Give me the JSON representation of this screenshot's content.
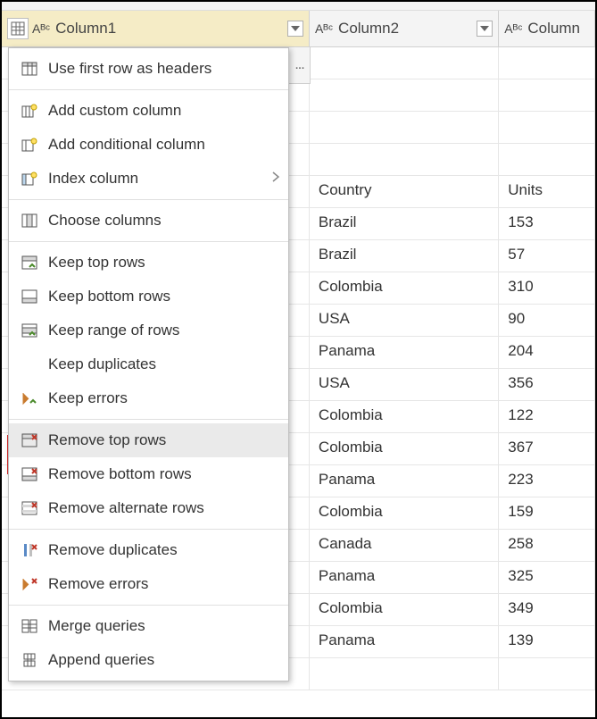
{
  "columns": [
    {
      "label": "Column1",
      "type_badge": "Aᴮᶜ"
    },
    {
      "label": "Column2",
      "type_badge": "Aᴮᶜ"
    },
    {
      "label": "Column",
      "type_badge": "Aᴮᶜ"
    }
  ],
  "rows": [
    {
      "c2": "",
      "c3": ""
    },
    {
      "c2": "",
      "c3": ""
    },
    {
      "c2": "",
      "c3": ""
    },
    {
      "c2": "",
      "c3": ""
    },
    {
      "c2": "Country",
      "c3": "Units"
    },
    {
      "c2": "Brazil",
      "c3": "153"
    },
    {
      "c2": "Brazil",
      "c3": "57"
    },
    {
      "c2": "Colombia",
      "c3": "310"
    },
    {
      "c2": "USA",
      "c3": "90"
    },
    {
      "c2": "Panama",
      "c3": "204"
    },
    {
      "c2": "USA",
      "c3": "356"
    },
    {
      "c2": "Colombia",
      "c3": "122"
    },
    {
      "c2": "Colombia",
      "c3": "367"
    },
    {
      "c2": "Panama",
      "c3": "223"
    },
    {
      "c2": "Colombia",
      "c3": "159"
    },
    {
      "c2": "Canada",
      "c3": "258"
    },
    {
      "c2": "Panama",
      "c3": "325"
    },
    {
      "c2": "Colombia",
      "c3": "349"
    },
    {
      "c2": "Panama",
      "c3": "139"
    },
    {
      "c2": "",
      "c3": ""
    }
  ],
  "menu": {
    "use_first_row": "Use first row as headers",
    "add_custom": "Add custom column",
    "add_conditional": "Add conditional column",
    "index_column": "Index column",
    "choose_columns": "Choose columns",
    "keep_top": "Keep top rows",
    "keep_bottom": "Keep bottom rows",
    "keep_range": "Keep range of rows",
    "keep_dup": "Keep duplicates",
    "keep_err": "Keep errors",
    "remove_top": "Remove top rows",
    "remove_bottom": "Remove bottom rows",
    "remove_alt": "Remove alternate rows",
    "remove_dup": "Remove duplicates",
    "remove_err": "Remove errors",
    "merge_q": "Merge queries",
    "append_q": "Append queries"
  },
  "ellipsis": "..."
}
